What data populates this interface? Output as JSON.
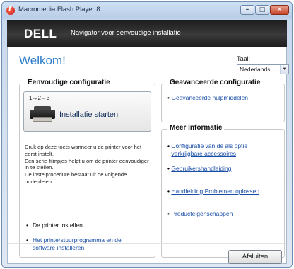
{
  "window": {
    "title": "Macromedia Flash Player 8"
  },
  "banner": {
    "logo": "DELL",
    "subtitle": "Navigator voor eenvoudige installatie"
  },
  "main": {
    "welcome": "Welkom!",
    "language_label": "Taal:",
    "language_value": "Nederlands"
  },
  "simple": {
    "title": "Eenvoudige configuratie",
    "steps": "1→2→3",
    "install_label": "Installatie starten",
    "description": [
      "Druk op deze toets wanneer u de printer voor het eerst instelt.",
      "Een serie filmpjes helpt u om de printer eenvoudiger in te stellen.",
      "De instelprocedure bestaat uit de volgende onderdelen:"
    ],
    "bullets": [
      {
        "text": "De printer instellen",
        "link": false
      },
      {
        "text": "Het printerstuurprogramma en de software installeren",
        "link": true
      }
    ]
  },
  "advanced": {
    "title": "Geavanceerde configuratie",
    "link": "Geavanceerde hulpmiddelen"
  },
  "info": {
    "title": "Meer informatie",
    "links": [
      "Configuratie van de als optie verkrijgbare accessoires",
      "Gebruikershandleiding",
      "Handleiding Problemen oplossen",
      "Producteigenschappen"
    ]
  },
  "footer": {
    "close_label": "Afsluiten"
  }
}
